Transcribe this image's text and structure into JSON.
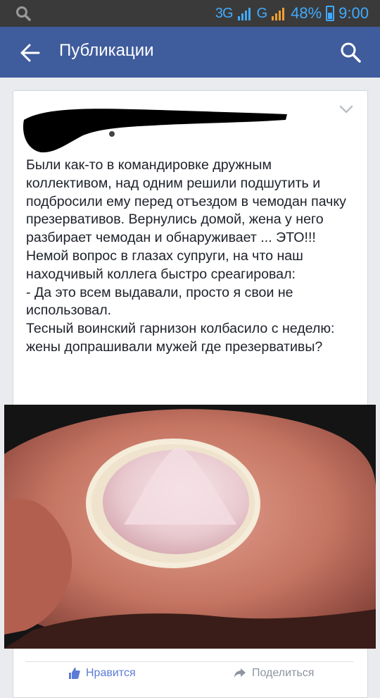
{
  "status_bar": {
    "network": "3G",
    "network2": "G",
    "battery": "48%",
    "battery_level": 0.48,
    "time": "9:00"
  },
  "app_bar": {
    "title": "Публикации"
  },
  "post": {
    "text": "Были как-то в командировке дружным коллективом, над одним решили подшутить и подбросили ему перед отъездом в чемодан пачку презервативов. Вернулись домой, жена у него разбирает чемодан и обнаруживает ... ЭТО!!! Немой вопрос в глазах супруги, на что наш находчивый коллега быстро среагировал:\n- Да это всем выдавали, просто я свои не использовал.\nТесный воинский гарнизон колбасило с неделю: жены допрашивали мужей где презервативы?"
  },
  "actions": {
    "like": "Нравится",
    "share": "Поделиться"
  },
  "colors": {
    "app_bar": "#3f5c9d",
    "status_accent": "#40aaff",
    "like_accent": "#5b7bd5"
  }
}
